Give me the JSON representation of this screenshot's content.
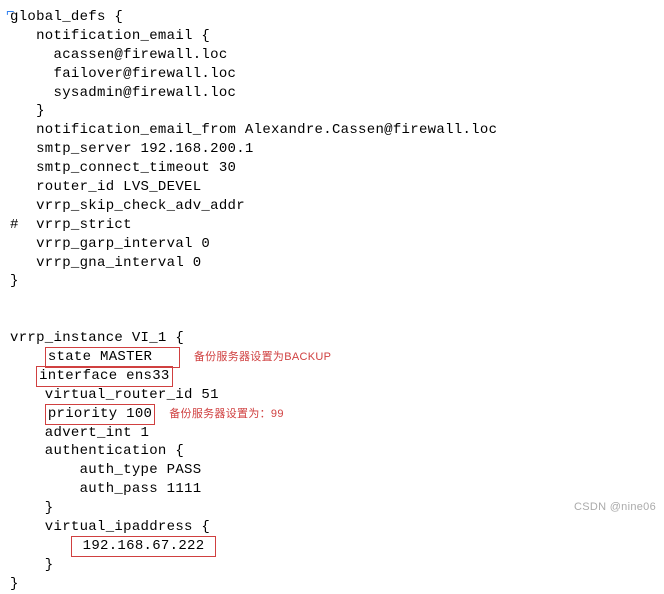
{
  "global_defs": {
    "header": "global_defs {",
    "notif_email_open": "   notification_email {",
    "email1": "     acassen@firewall.loc",
    "email2": "     failover@firewall.loc",
    "email3": "     sysadmin@firewall.loc",
    "notif_email_close": "   }",
    "notif_from": "   notification_email_from Alexandre.Cassen@firewall.loc",
    "smtp_server": "   smtp_server 192.168.200.1",
    "smtp_timeout": "   smtp_connect_timeout 30",
    "router_id": "   router_id LVS_DEVEL",
    "skip_check": "   vrrp_skip_check_adv_addr",
    "strict": "#  vrrp_strict",
    "garp": "   vrrp_garp_interval 0",
    "gna": "   vrrp_gna_interval 0",
    "close": "}"
  },
  "vrrp_instance": {
    "header": "vrrp_instance VI_1 {",
    "state_pre": "    ",
    "state": "state MASTER",
    "ann_state": "备份服务器设置为BACKUP",
    "iface_pre": "   ",
    "iface": "interface ens33",
    "vrid": "    virtual_router_id 51",
    "prio_pre": "    ",
    "prio": "priority 100",
    "ann_prio": "备份服务器设置为：99",
    "advert": "    advert_int 1",
    "auth_open": "    authentication {",
    "auth_type": "        auth_type PASS",
    "auth_pass": "        auth_pass 1111",
    "auth_close": "    }",
    "vip_open": "    virtual_ipaddress {",
    "vip_pre": "       ",
    "vip": " 192.168.67.222 ",
    "vip_close": "    }",
    "close": "}"
  },
  "watermark": "CSDN @nine06"
}
